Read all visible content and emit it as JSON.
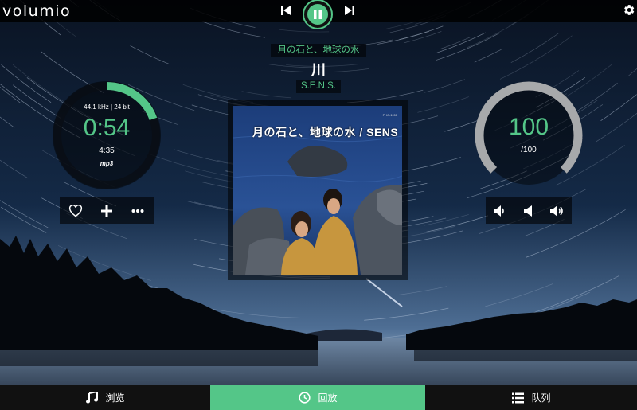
{
  "app": {
    "logo_text": "volumio"
  },
  "colors": {
    "accent": "#54c688",
    "bar_bg": "#111111"
  },
  "transport": {
    "prev_icon": "skip-previous-icon",
    "playpause_icon": "pause-icon",
    "next_icon": "skip-next-icon",
    "settings_icon": "gear-icon",
    "state": "playing"
  },
  "track": {
    "album": "月の石と、地球の水",
    "title": "川",
    "artist": "S.E.N.S."
  },
  "progress": {
    "format": "44.1 kHz | 24 bit",
    "elapsed": "0:54",
    "duration": "4:35",
    "codec": "mp3",
    "fraction": 0.196
  },
  "actions": [
    {
      "icon": "heart-icon"
    },
    {
      "icon": "plus-icon"
    },
    {
      "icon": "more-icon"
    }
  ],
  "album_art": {
    "title_text": "月の石と、地球の水 / SENS",
    "catalog_text": "PHC-1151"
  },
  "volume": {
    "value": "100",
    "max_label": "/100",
    "fraction": 1.0,
    "controls": [
      {
        "icon": "volume-down-icon"
      },
      {
        "icon": "mute-icon"
      },
      {
        "icon": "volume-up-icon"
      }
    ]
  },
  "nav": {
    "browse": {
      "label": "浏览",
      "icon": "music-note-icon"
    },
    "playback": {
      "label": "回放",
      "icon": "clock-icon",
      "active": true
    },
    "queue": {
      "label": "队列",
      "icon": "list-icon"
    }
  }
}
